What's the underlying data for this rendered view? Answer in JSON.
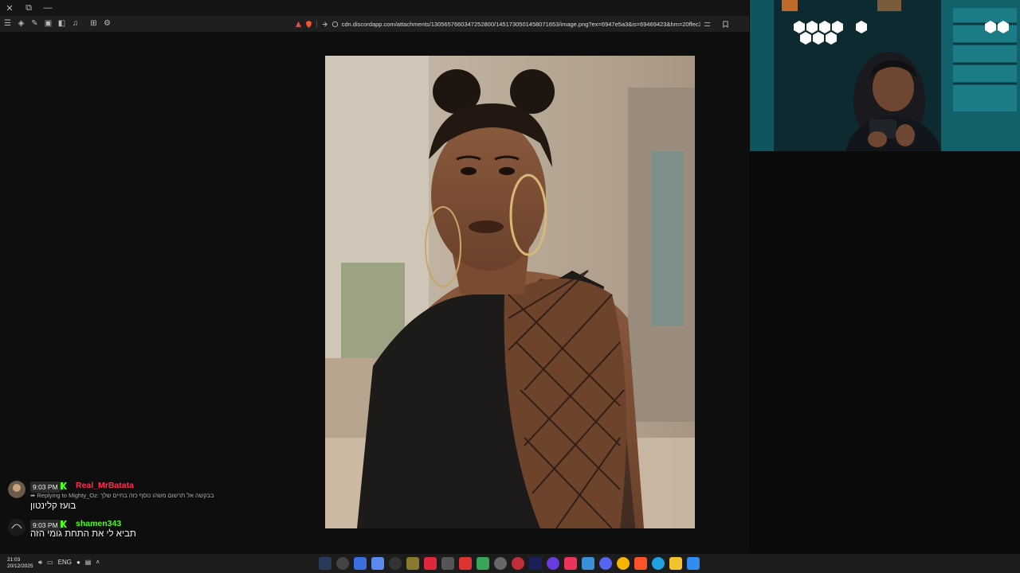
{
  "browser": {
    "url": "cdn.discordapp.com/attachments/1305657660347252800/1451730501458071653/image.png?ex=6947e5a3&is=69469423&hm=20ffec3d0f185...",
    "close_glyph": "✕",
    "restore_glyph": "⧉",
    "minimize_glyph": "—"
  },
  "chat": {
    "messages": [
      {
        "time": "9:03 PM",
        "username": "Real_MrBatata",
        "username_color": "#ff2d55",
        "reply": "➦ Replying to Mighty_Oz: בבקשה אל תרשום משהו נוסף כזה בחיים שלך",
        "text": "בועז קלינטון"
      },
      {
        "time": "9:03 PM",
        "username": "shamen343",
        "username_color": "#53fc18",
        "text": "תביא לי את התחת גומי הזה"
      }
    ]
  },
  "taskbar": {
    "time": "21:03",
    "date": "20/12/2025",
    "language": "ENG"
  },
  "colors": {
    "kick_green": "#53fc18",
    "webcam_teal": "#19c6d8"
  }
}
